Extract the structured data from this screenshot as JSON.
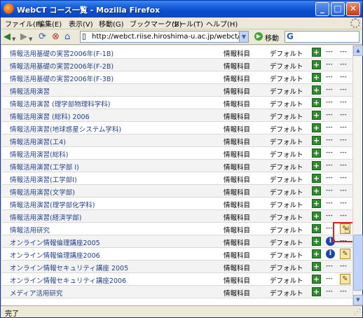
{
  "window": {
    "title": "WebCT コース一覧 - Mozilla Firefox"
  },
  "menu": [
    "ファイル(F)",
    "編集(E)",
    "表示(V)",
    "移動(G)",
    "ブックマーク(B)",
    "ツール(T)",
    "ヘルプ(H)"
  ],
  "nav": {
    "url": "http://webct.riise.hiroshima-u.ac.jp/webct/homearea/r",
    "go_label": "移動",
    "search_value": ""
  },
  "courses": [
    {
      "name": "情報活用基礎の実習2006年(F-1B)",
      "type": "情報科目",
      "default": "デフォルト",
      "mid": "---",
      "end": "---",
      "info": false,
      "edit": false
    },
    {
      "name": "情報活用基礎の実習2006年(F-2B)",
      "type": "情報科目",
      "default": "デフォルト",
      "mid": "---",
      "end": "---",
      "info": false,
      "edit": false
    },
    {
      "name": "情報活用基礎の実習2006年(F-3B)",
      "type": "情報科目",
      "default": "デフォルト",
      "mid": "---",
      "end": "---",
      "info": false,
      "edit": false
    },
    {
      "name": "情報活用演習",
      "type": "情報科目",
      "default": "デフォルト",
      "mid": "---",
      "end": "---",
      "info": false,
      "edit": false
    },
    {
      "name": "情報活用演習 (理学部物理科学科)",
      "type": "情報科目",
      "default": "デフォルト",
      "mid": "---",
      "end": "---",
      "info": false,
      "edit": false
    },
    {
      "name": "情報活用演習 (総科) 2006",
      "type": "情報科目",
      "default": "デフォルト",
      "mid": "---",
      "end": "---",
      "info": false,
      "edit": false
    },
    {
      "name": "情報活用演習(地球惑星システム学科)",
      "type": "情報科目",
      "default": "デフォルト",
      "mid": "---",
      "end": "---",
      "info": false,
      "edit": false
    },
    {
      "name": "情報活用演習(工4)",
      "type": "情報科目",
      "default": "デフォルト",
      "mid": "---",
      "end": "---",
      "info": false,
      "edit": false
    },
    {
      "name": "情報活用演習(総科)",
      "type": "情報科目",
      "default": "デフォルト",
      "mid": "---",
      "end": "---",
      "info": false,
      "edit": false
    },
    {
      "name": "情報活用演習(工学部 I)",
      "type": "情報科目",
      "default": "デフォルト",
      "mid": "---",
      "end": "---",
      "info": false,
      "edit": false
    },
    {
      "name": "情報活用演習(工学部I)",
      "type": "情報科目",
      "default": "デフォルト",
      "mid": "---",
      "end": "---",
      "info": false,
      "edit": false
    },
    {
      "name": "情報活用演習(文学部)",
      "type": "情報科目",
      "default": "デフォルト",
      "mid": "---",
      "end": "---",
      "info": false,
      "edit": false
    },
    {
      "name": "情報活用演習(理学部化学科)",
      "type": "情報科目",
      "default": "デフォルト",
      "mid": "---",
      "end": "---",
      "info": false,
      "edit": false
    },
    {
      "name": "情報活用演習(経済学部)",
      "type": "情報科目",
      "default": "デフォルト",
      "mid": "---",
      "end": "---",
      "info": false,
      "edit": false
    },
    {
      "name": "情報活用研究",
      "type": "情報科目",
      "default": "デフォルト",
      "mid": "---",
      "end": "",
      "info": false,
      "edit": true
    },
    {
      "name": "オンライン情報倫理講座2005",
      "type": "情報科目",
      "default": "デフォルト",
      "mid": "",
      "end": "---",
      "info": true,
      "edit": false
    },
    {
      "name": "オンライン情報倫理講座2006",
      "type": "情報科目",
      "default": "デフォルト",
      "mid": "",
      "end": "",
      "info": true,
      "edit": true
    },
    {
      "name": "オンライン情報セキュリティ講座 2005",
      "type": "情報科目",
      "default": "デフォルト",
      "mid": "---",
      "end": "---",
      "info": false,
      "edit": false
    },
    {
      "name": "オンライン情報セキュリティ講座2006",
      "type": "情報科目",
      "default": "デフォルト",
      "mid": "---",
      "end": "",
      "info": false,
      "edit": true
    },
    {
      "name": "メディア活用研究",
      "type": "情報科目",
      "default": "デフォルト",
      "mid": "---",
      "end": "---",
      "info": false,
      "edit": false
    }
  ],
  "status": {
    "text": "完了"
  }
}
